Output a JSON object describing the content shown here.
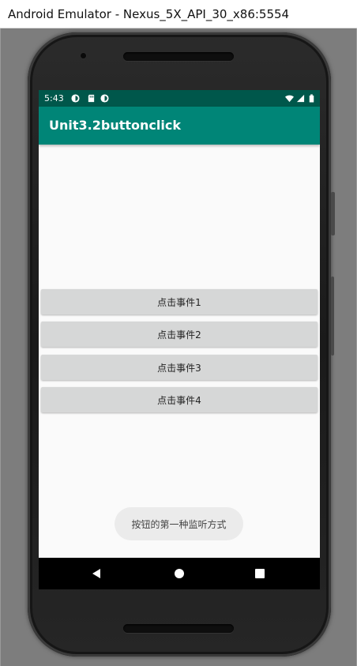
{
  "window": {
    "title": "Android Emulator - Nexus_5X_API_30_x86:5554"
  },
  "status_bar": {
    "time": "5:43"
  },
  "app_bar": {
    "title": "Unit3.2buttonclick"
  },
  "buttons": [
    {
      "label": "点击事件1"
    },
    {
      "label": "点击事件2"
    },
    {
      "label": "点击事件3"
    },
    {
      "label": "点击事件4"
    }
  ],
  "toast": {
    "text": "按钮的第一种监听方式"
  },
  "colors": {
    "status_bar": "#00574b",
    "app_bar": "#008577",
    "button_bg": "#d6d7d7",
    "screen_bg": "#fafafa"
  },
  "nav_bar": {
    "icons": [
      "back-icon",
      "home-icon",
      "recents-icon"
    ]
  }
}
